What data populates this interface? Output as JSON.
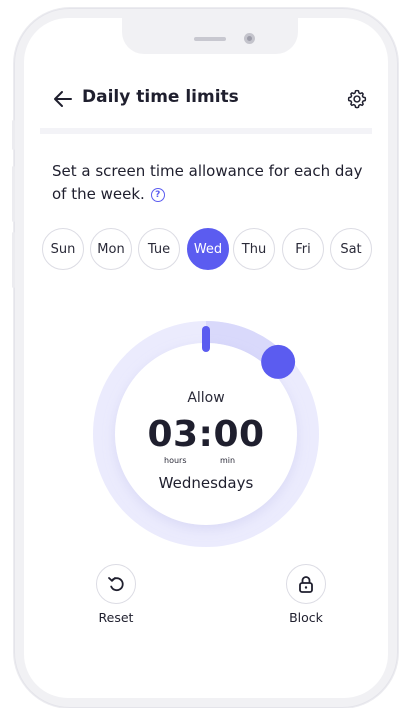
{
  "header": {
    "title": "Daily time limits"
  },
  "description": {
    "text": "Set a screen time allowance for each day of the week."
  },
  "days": [
    {
      "label": "Sun",
      "selected": false
    },
    {
      "label": "Mon",
      "selected": false
    },
    {
      "label": "Tue",
      "selected": false
    },
    {
      "label": "Wed",
      "selected": true
    },
    {
      "label": "Thu",
      "selected": false
    },
    {
      "label": "Fri",
      "selected": false
    },
    {
      "label": "Sat",
      "selected": false
    }
  ],
  "dial": {
    "allow_label": "Allow",
    "time": "03:00",
    "hours_unit": "hours",
    "min_unit": "min",
    "day_label": "Wednesdays",
    "fill_fraction": 0.125
  },
  "actions": {
    "reset_label": "Reset",
    "block_label": "Block"
  },
  "colors": {
    "accent": "#5b5cf0",
    "ring_track": "#ebebfd",
    "ring_fill": "#d9d9fb"
  },
  "icons": [
    "back-arrow-icon",
    "gear-icon",
    "help-icon",
    "reset-icon",
    "lock-icon"
  ]
}
